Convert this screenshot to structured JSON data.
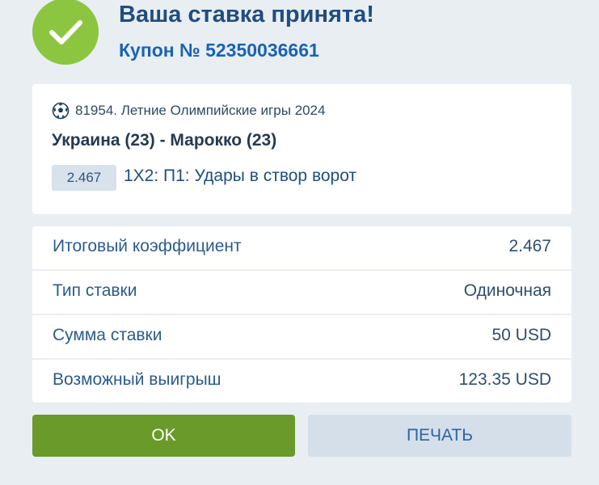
{
  "header": {
    "title": "Ваша ставка принята!",
    "coupon": "Купон № 52350036661",
    "success_icon": "checkmark-icon",
    "success_color": "#8cc641"
  },
  "event": {
    "sport_icon": "soccer-ball-icon",
    "meta": "81954. Летние Олимпийские игры 2024",
    "match": "Украина (23) - Марокко (23)",
    "odd": "2.467",
    "market": "1X2: П1: Удары в створ ворот"
  },
  "summary": {
    "rows": [
      {
        "label": "Итоговый коэффициент",
        "value": "2.467"
      },
      {
        "label": "Тип ставки",
        "value": "Одиночная"
      },
      {
        "label": "Сумма ставки",
        "value": "50 USD"
      },
      {
        "label": "Возможный выигрыш",
        "value": "123.35 USD"
      }
    ]
  },
  "buttons": {
    "ok_label": "OK",
    "print_label": "ПЕЧАТЬ",
    "ok_color": "#6a9a2a",
    "print_color": "#d4dfe9"
  }
}
